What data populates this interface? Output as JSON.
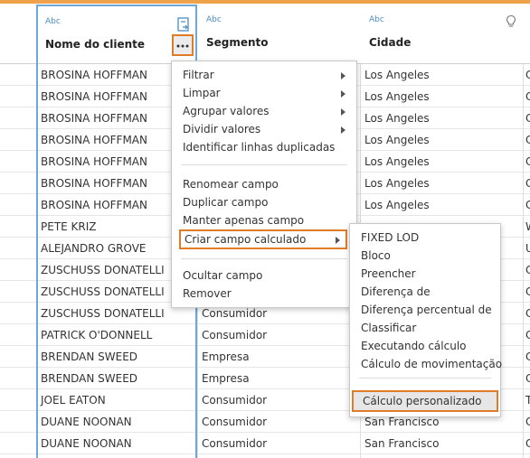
{
  "headers": [
    {
      "type": "Abc",
      "name": "Nome do cliente"
    },
    {
      "type": "Abc",
      "name": "Segmento"
    },
    {
      "type": "Abc",
      "name": "Cidade"
    }
  ],
  "rows": [
    {
      "c1": "BROSINA HOFFMAN",
      "c2": "",
      "c3": "Los Angeles",
      "c4": "C"
    },
    {
      "c1": "BROSINA HOFFMAN",
      "c2": "",
      "c3": "Los Angeles",
      "c4": "C"
    },
    {
      "c1": "BROSINA HOFFMAN",
      "c2": "",
      "c3": "Los Angeles",
      "c4": "C"
    },
    {
      "c1": "BROSINA HOFFMAN",
      "c2": "",
      "c3": "Los Angeles",
      "c4": "C"
    },
    {
      "c1": "BROSINA HOFFMAN",
      "c2": "",
      "c3": "Los Angeles",
      "c4": "C"
    },
    {
      "c1": "BROSINA HOFFMAN",
      "c2": "",
      "c3": "Los Angeles",
      "c4": "C"
    },
    {
      "c1": "BROSINA HOFFMAN",
      "c2": "",
      "c3": "Los Angeles",
      "c4": "C"
    },
    {
      "c1": "PETE KRIZ",
      "c2": "",
      "c3": "",
      "c4": "W"
    },
    {
      "c1": "ALEJANDRO GROVE",
      "c2": "",
      "c3": "",
      "c4": "U"
    },
    {
      "c1": "ZUSCHUSS DONATELLI",
      "c2": "",
      "c3": "",
      "c4": "C"
    },
    {
      "c1": "ZUSCHUSS DONATELLI",
      "c2": "",
      "c3": "",
      "c4": "C"
    },
    {
      "c1": "ZUSCHUSS DONATELLI",
      "c2": "Consumidor",
      "c3": "",
      "c4": "C"
    },
    {
      "c1": "PATRICK O'DONNELL",
      "c2": "Consumidor",
      "c3": "",
      "c4": "C"
    },
    {
      "c1": "BRENDAN SWEED",
      "c2": "Empresa",
      "c3": "",
      "c4": "C"
    },
    {
      "c1": "BRENDAN SWEED",
      "c2": "Empresa",
      "c3": "",
      "c4": "C"
    },
    {
      "c1": "JOEL EATON",
      "c2": "Consumidor",
      "c3": "",
      "c4": "T"
    },
    {
      "c1": "DUANE NOONAN",
      "c2": "Consumidor",
      "c3": "San Francisco",
      "c4": "C"
    },
    {
      "c1": "DUANE NOONAN",
      "c2": "Consumidor",
      "c3": "San Francisco",
      "c4": "C"
    }
  ],
  "context_menu": {
    "items": [
      {
        "label": "Filtrar",
        "submenu": true
      },
      {
        "label": "Limpar",
        "submenu": true
      },
      {
        "label": "Agrupar valores",
        "submenu": true
      },
      {
        "label": "Dividir valores",
        "submenu": true
      },
      {
        "label": "Identificar linhas duplicadas",
        "submenu": false
      },
      {
        "label": "Renomear campo",
        "submenu": false
      },
      {
        "label": "Duplicar campo",
        "submenu": false
      },
      {
        "label": "Manter apenas campo",
        "submenu": false
      },
      {
        "label": "Criar campo calculado",
        "submenu": true,
        "highlighted": true
      },
      {
        "label": "Ocultar campo",
        "submenu": false
      },
      {
        "label": "Remover",
        "submenu": false
      }
    ]
  },
  "submenu": {
    "items": [
      {
        "label": "FIXED LOD"
      },
      {
        "label": "Bloco"
      },
      {
        "label": "Preencher"
      },
      {
        "label": "Diferença de"
      },
      {
        "label": "Diferença percentual de"
      },
      {
        "label": "Classificar"
      },
      {
        "label": "Executando cálculo"
      },
      {
        "label": "Cálculo de movimentação"
      },
      {
        "label": "Cálculo personalizado",
        "highlighted": true
      }
    ]
  },
  "colors": {
    "accent": "#f0a24a",
    "selection": "#6aa9d8",
    "highlight_border": "#e07b28"
  },
  "icons": [
    "change-type-icon",
    "more-options-icon",
    "lightbulb-icon",
    "chevron-right-icon"
  ]
}
